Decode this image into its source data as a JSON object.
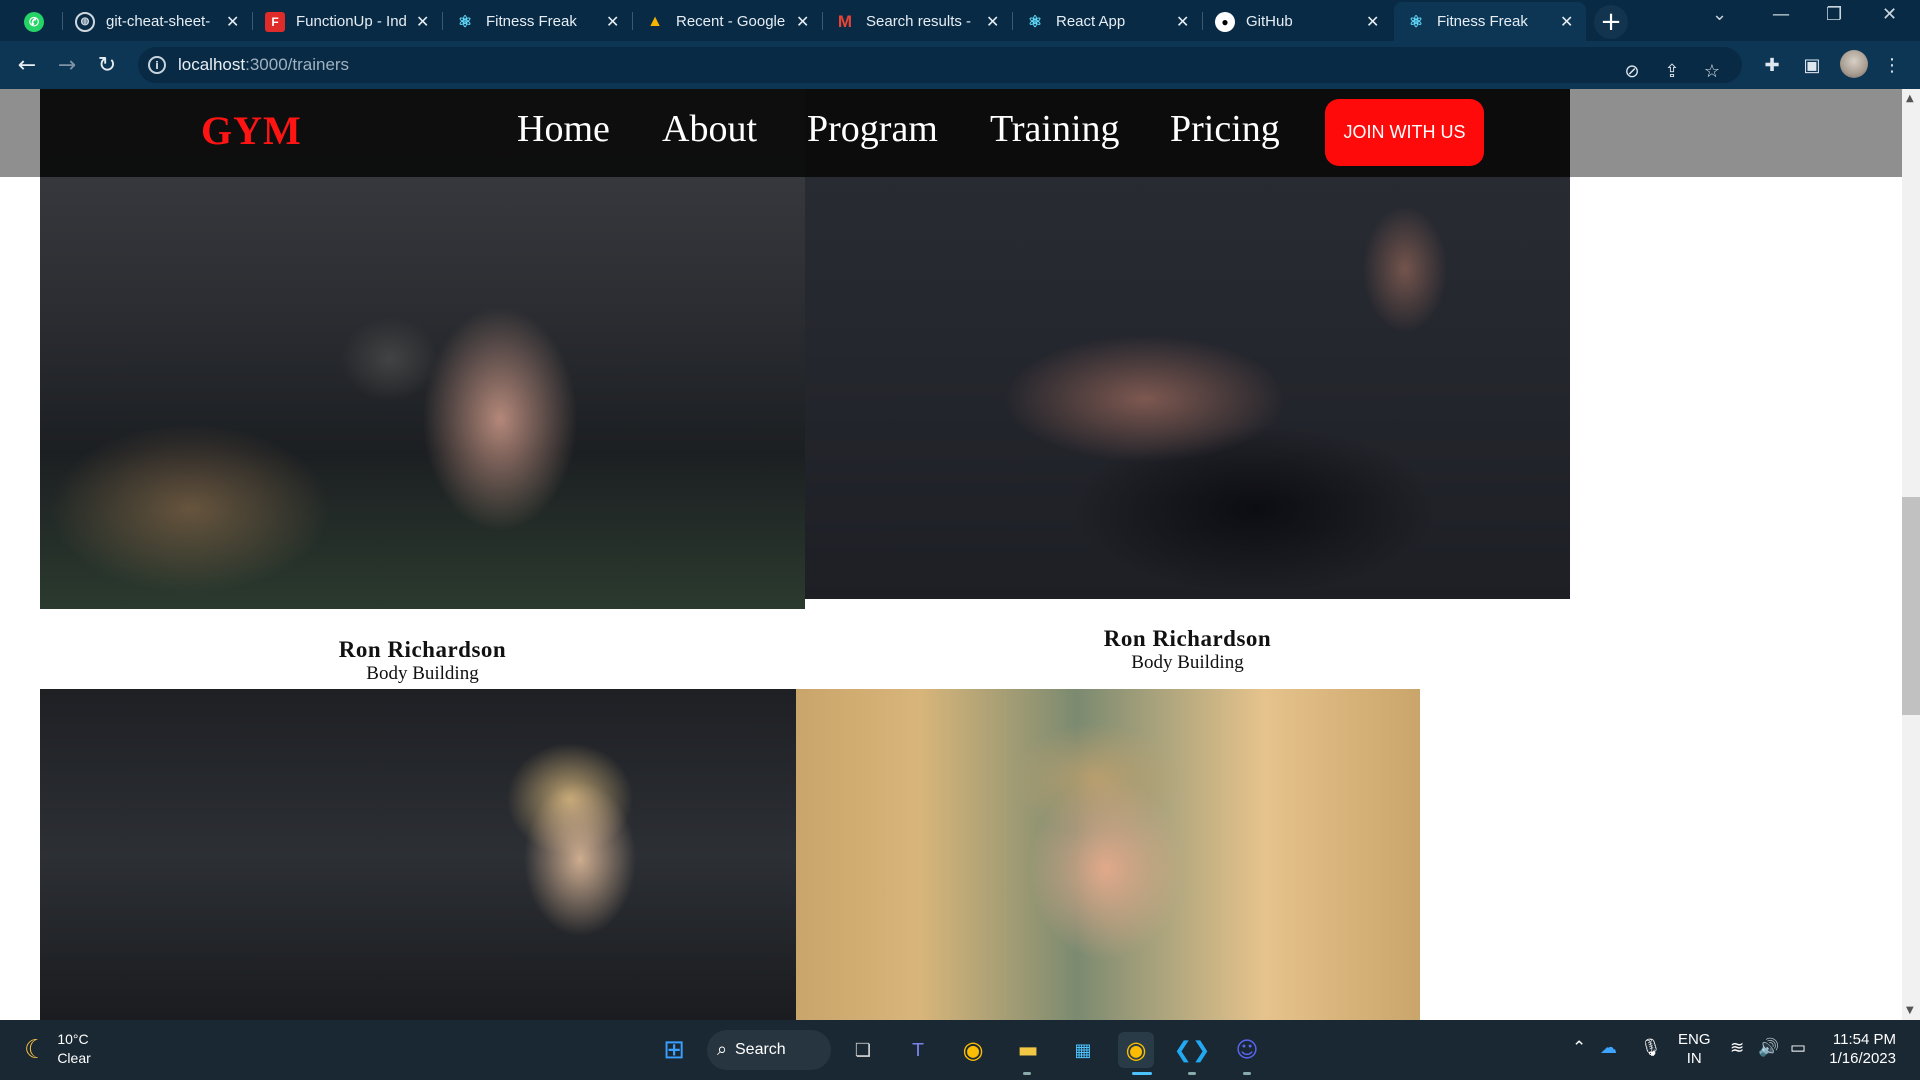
{
  "browser": {
    "tabs": [
      {
        "title": "",
        "icon": "whatsapp-icon",
        "pinned": true
      },
      {
        "title": "git-cheat-sheet-",
        "icon": "globe-icon"
      },
      {
        "title": "FunctionUp - Ind",
        "icon": "functionup-icon"
      },
      {
        "title": "Fitness Freak",
        "icon": "react-icon"
      },
      {
        "title": "Recent - Google",
        "icon": "google-drive-icon"
      },
      {
        "title": "Search results - ",
        "icon": "gmail-icon"
      },
      {
        "title": "React App",
        "icon": "react-icon"
      },
      {
        "title": "GitHub",
        "icon": "github-icon"
      },
      {
        "title": "Fitness Freak",
        "icon": "react-icon",
        "active": true
      }
    ],
    "url_host": "localhost",
    "url_path": ":3000/trainers"
  },
  "site": {
    "logo": "GYM",
    "nav": [
      "Home",
      "About",
      "Program",
      "Training",
      "Pricing"
    ],
    "cta": "JOIN WITH US",
    "trainers": [
      {
        "name": "Ron Richardson",
        "role": "Body Building"
      },
      {
        "name": "Ron Richardson",
        "role": "Body Building"
      }
    ],
    "colors": {
      "logo": "#ff1414",
      "cta": "#ff0a0a",
      "navbar": "#080808"
    }
  },
  "taskbar": {
    "weather_temp": "10°C",
    "weather_cond": "Clear",
    "search_label": "Search",
    "lang_top": "ENG",
    "lang_bottom": "IN",
    "time": "11:54 PM",
    "date": "1/16/2023"
  }
}
